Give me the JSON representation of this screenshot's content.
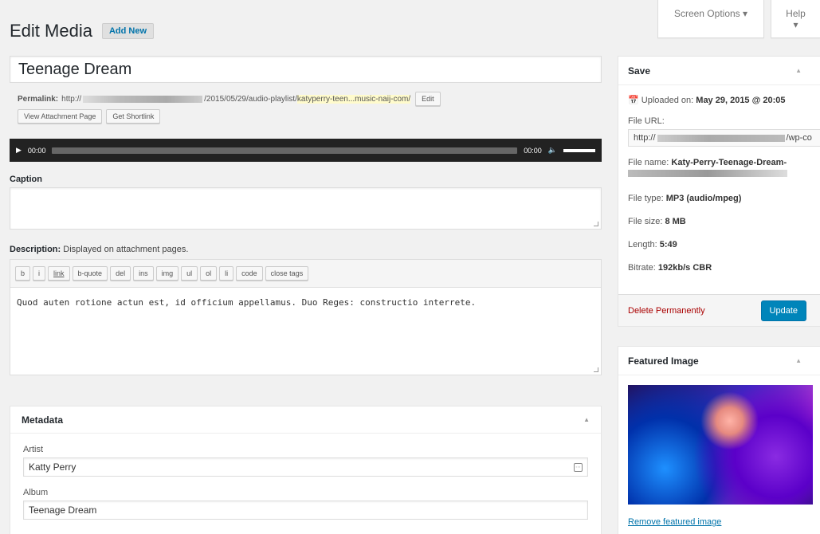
{
  "screen_meta": {
    "screen_options": "Screen Options ▾",
    "help": "Help ▾"
  },
  "heading": {
    "title": "Edit Media",
    "add_new": "Add New"
  },
  "post_title": "Teenage Dream",
  "permalink": {
    "label": "Permalink:",
    "prefix": "http://",
    "path": "/2015/05/29/audio-playlist/",
    "slug": "katyperry-teen...music-naij-com/",
    "edit_label": "Edit",
    "view_attachment": "View Attachment Page",
    "get_shortlink": "Get Shortlink"
  },
  "player": {
    "current_time": "00:00",
    "duration": "00:00"
  },
  "caption": {
    "label": "Caption",
    "value": ""
  },
  "description": {
    "label": "Description:",
    "hint": "Displayed on attachment pages.",
    "quicktags": [
      "b",
      "i",
      "link",
      "b-quote",
      "del",
      "ins",
      "img",
      "ul",
      "ol",
      "li",
      "code",
      "close tags"
    ],
    "content": "Quod auten rotione actun est, id officium appellamus. Duo Reges: constructio interrete."
  },
  "metadata": {
    "title": "Metadata",
    "artist_label": "Artist",
    "artist_value": "Katty Perry",
    "album_label": "Album",
    "album_value": "Teenage Dream"
  },
  "save": {
    "title": "Save",
    "uploaded_label": "Uploaded on:",
    "uploaded_value": "May 29, 2015 @ 20:05",
    "file_url_label": "File URL:",
    "file_url_prefix": "http://",
    "file_url_suffix": "/wp-co",
    "file_name_label": "File name:",
    "file_name_value": "Katy-Perry-Teenage-Dream-",
    "file_type_label": "File type:",
    "file_type_value": "MP3 (audio/mpeg)",
    "file_size_label": "File size:",
    "file_size_value": "8 MB",
    "length_label": "Length:",
    "length_value": "5:49",
    "bitrate_label": "Bitrate:",
    "bitrate_value": "192kb/s CBR",
    "delete_label": "Delete Permanently",
    "update_label": "Update"
  },
  "featured_image": {
    "title": "Featured Image",
    "remove_label": "Remove featured image"
  },
  "colors": {
    "accent": "#0085ba",
    "link": "#0073aa",
    "delete": "#a00000",
    "slug_highlight": "#fffbcc"
  }
}
